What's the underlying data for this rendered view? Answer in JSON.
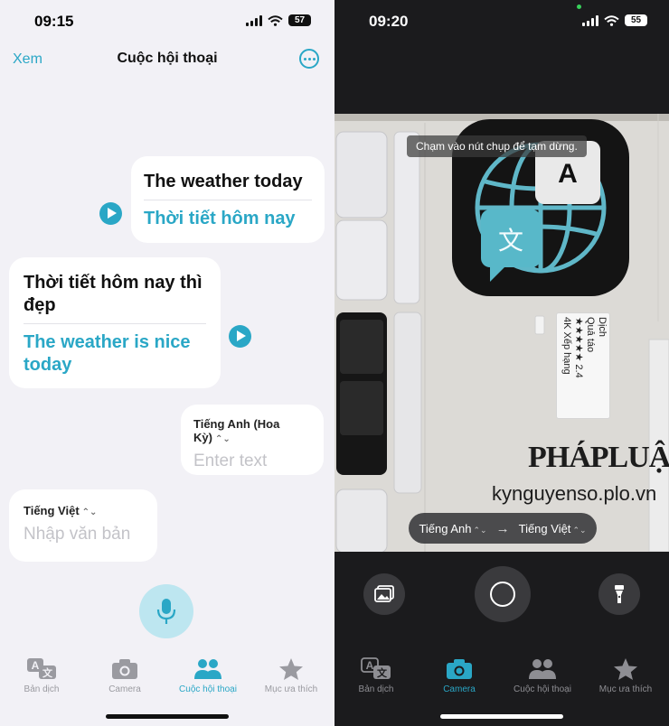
{
  "left": {
    "status": {
      "time": "09:15",
      "battery": "57"
    },
    "nav": {
      "left_button": "Xem",
      "title": "Cuộc hội thoại"
    },
    "messages": [
      {
        "source": "The weather today",
        "translation": "Thời tiết hôm nay"
      },
      {
        "source": "Thời tiết hôm nay thì đẹp",
        "translation": "The weather is nice today"
      }
    ],
    "input_english": {
      "language": "Tiếng Anh (Hoa Kỳ)",
      "placeholder": "Enter text"
    },
    "input_vietnamese": {
      "language": "Tiếng Việt",
      "placeholder": "Nhập văn bản"
    },
    "tabs": [
      {
        "label": "Bản dịch",
        "icon": "translate-icon",
        "active": false
      },
      {
        "label": "Camera",
        "icon": "camera-icon",
        "active": false
      },
      {
        "label": "Cuộc hội thoại",
        "icon": "people-icon",
        "active": true
      },
      {
        "label": "Mục ưa thích",
        "icon": "star-icon",
        "active": false
      }
    ]
  },
  "right": {
    "status": {
      "time": "09:20",
      "battery": "55"
    },
    "camera": {
      "hint": "Chạm vào nút chụp để tạm dừng.",
      "overlay_card_lines": [
        "Dịch",
        "Quả táo",
        "★★★★★ 2.4",
        "4K Xếp hạng"
      ],
      "watermark_brand": "PHÁPLUẬT",
      "watermark_site": "kynguyenso.plo.vn",
      "source_language": "Tiếng Anh",
      "target_language": "Tiếng Việt"
    },
    "tabs": [
      {
        "label": "Bản dịch",
        "icon": "translate-icon",
        "active": false
      },
      {
        "label": "Camera",
        "icon": "camera-icon",
        "active": true
      },
      {
        "label": "Cuộc hội thoại",
        "icon": "people-icon",
        "active": false
      },
      {
        "label": "Mục ưa thích",
        "icon": "star-icon",
        "active": false
      }
    ]
  },
  "colors": {
    "accent": "#2aa7c6",
    "left_bg": "#f2f1f6",
    "right_bg": "#1b1b1d",
    "inactive_tab_light": "#9a9aa0",
    "inactive_tab_dark": "#8e8e93"
  }
}
